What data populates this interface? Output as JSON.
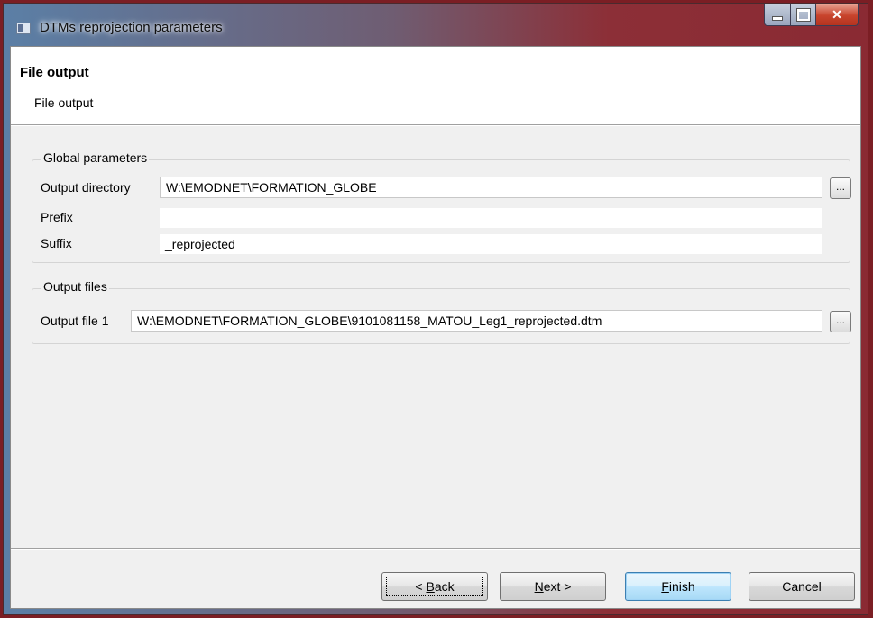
{
  "window": {
    "title": "DTMs reprojection parameters"
  },
  "header": {
    "title": "File output",
    "description": "File output"
  },
  "global_parameters": {
    "group_label": "Global parameters",
    "output_directory_label": "Output directory",
    "output_directory_value": "W:\\EMODNET\\FORMATION_GLOBE",
    "prefix_label": "Prefix",
    "prefix_value": "",
    "suffix_label": "Suffix",
    "suffix_value": "_reprojected",
    "browse_label": "..."
  },
  "output_files": {
    "group_label": "Output files",
    "file1_label": "Output file 1",
    "file1_value": "W:\\EMODNET\\FORMATION_GLOBE\\9101081158_MATOU_Leg1_reprojected.dtm",
    "browse_label": "..."
  },
  "buttons": {
    "back_prefix": "< ",
    "back_mnemonic": "B",
    "back_rest": "ack",
    "next_mnemonic": "N",
    "next_rest": "ext >",
    "finish_mnemonic": "F",
    "finish_rest": "inish",
    "cancel": "Cancel"
  },
  "icons": {
    "app": "window-app-icon",
    "minimize": "minimize-icon",
    "maximize": "maximize-icon",
    "close": "close-icon"
  }
}
